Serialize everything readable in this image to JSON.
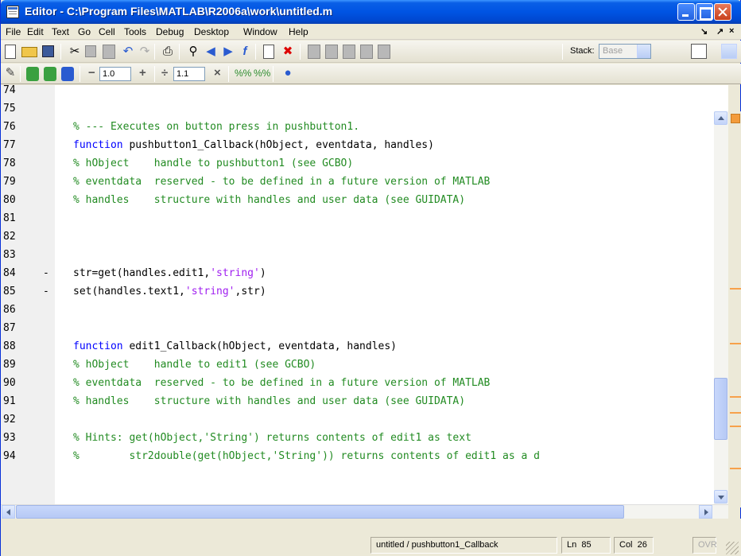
{
  "window": {
    "title": "Editor - C:\\Program Files\\MATLAB\\R2006a\\work\\untitled.m"
  },
  "menu": [
    "File",
    "Edit",
    "Text",
    "Go",
    "Cell",
    "Tools",
    "Debug",
    "Desktop",
    "Window",
    "Help"
  ],
  "menu_controls": [
    "↘",
    "↗",
    "×"
  ],
  "toolbar": {
    "stack_label": "Stack:",
    "stack_value": "Base",
    "decrement_label": "−",
    "decrement_value": "1.0",
    "increment_label": "+",
    "divide_label": "÷",
    "divide_value": "1.1",
    "multiply_label": "×"
  },
  "code_lines": [
    {
      "ln": "74",
      "bp": "",
      "parts": []
    },
    {
      "ln": "75",
      "bp": "",
      "parts": []
    },
    {
      "ln": "76",
      "bp": "",
      "parts": [
        {
          "t": "% --- Executes on button press in pushbutton1.",
          "c": "cm"
        }
      ]
    },
    {
      "ln": "77",
      "bp": "",
      "parts": [
        {
          "t": "function",
          "c": "kw"
        },
        {
          "t": " pushbutton1_Callback(hObject, eventdata, handles)",
          "c": "tx"
        }
      ]
    },
    {
      "ln": "78",
      "bp": "",
      "parts": [
        {
          "t": "% hObject    handle to pushbutton1 (see GCBO)",
          "c": "cm"
        }
      ]
    },
    {
      "ln": "79",
      "bp": "",
      "parts": [
        {
          "t": "% eventdata  reserved - to be defined in a future version of MATLAB",
          "c": "cm"
        }
      ]
    },
    {
      "ln": "80",
      "bp": "",
      "parts": [
        {
          "t": "% handles    structure with handles and user data (see GUIDATA)",
          "c": "cm"
        }
      ]
    },
    {
      "ln": "81",
      "bp": "",
      "parts": []
    },
    {
      "ln": "82",
      "bp": "",
      "parts": []
    },
    {
      "ln": "83",
      "bp": "",
      "parts": []
    },
    {
      "ln": "84",
      "bp": "-",
      "parts": [
        {
          "t": "str=get(handles.edit1,",
          "c": "tx"
        },
        {
          "t": "'string'",
          "c": "st"
        },
        {
          "t": ")",
          "c": "tx"
        }
      ]
    },
    {
      "ln": "85",
      "bp": "-",
      "parts": [
        {
          "t": "set(handles.text1,",
          "c": "tx"
        },
        {
          "t": "'string'",
          "c": "st"
        },
        {
          "t": ",str)",
          "c": "tx"
        }
      ]
    },
    {
      "ln": "86",
      "bp": "",
      "parts": []
    },
    {
      "ln": "87",
      "bp": "",
      "parts": []
    },
    {
      "ln": "88",
      "bp": "",
      "parts": [
        {
          "t": "function",
          "c": "kw"
        },
        {
          "t": " edit1_Callback(hObject, eventdata, handles)",
          "c": "tx"
        }
      ]
    },
    {
      "ln": "89",
      "bp": "",
      "parts": [
        {
          "t": "% hObject    handle to edit1 (see GCBO)",
          "c": "cm"
        }
      ]
    },
    {
      "ln": "90",
      "bp": "",
      "parts": [
        {
          "t": "% eventdata  reserved - to be defined in a future version of MATLAB",
          "c": "cm"
        }
      ]
    },
    {
      "ln": "91",
      "bp": "",
      "parts": [
        {
          "t": "% handles    structure with handles and user data (see GUIDATA)",
          "c": "cm"
        }
      ]
    },
    {
      "ln": "92",
      "bp": "",
      "parts": []
    },
    {
      "ln": "93",
      "bp": "",
      "parts": [
        {
          "t": "% Hints: get(hObject,'String') returns contents of edit1 as text",
          "c": "cm"
        }
      ]
    },
    {
      "ln": "94",
      "bp": "",
      "parts": [
        {
          "t": "%        str2double(get(hObject,'String')) returns contents of edit1 as a d",
          "c": "cm"
        }
      ]
    }
  ],
  "status": {
    "function": "untitled / pushbutton1_Callback",
    "ln_label": "Ln",
    "ln_value": "85",
    "col_label": "Col",
    "col_value": "26",
    "ovr": "OVR"
  },
  "colors": {
    "keyword": "#0000ff",
    "comment": "#228b22",
    "string": "#a020f0",
    "title_bar": "#0054e3"
  }
}
